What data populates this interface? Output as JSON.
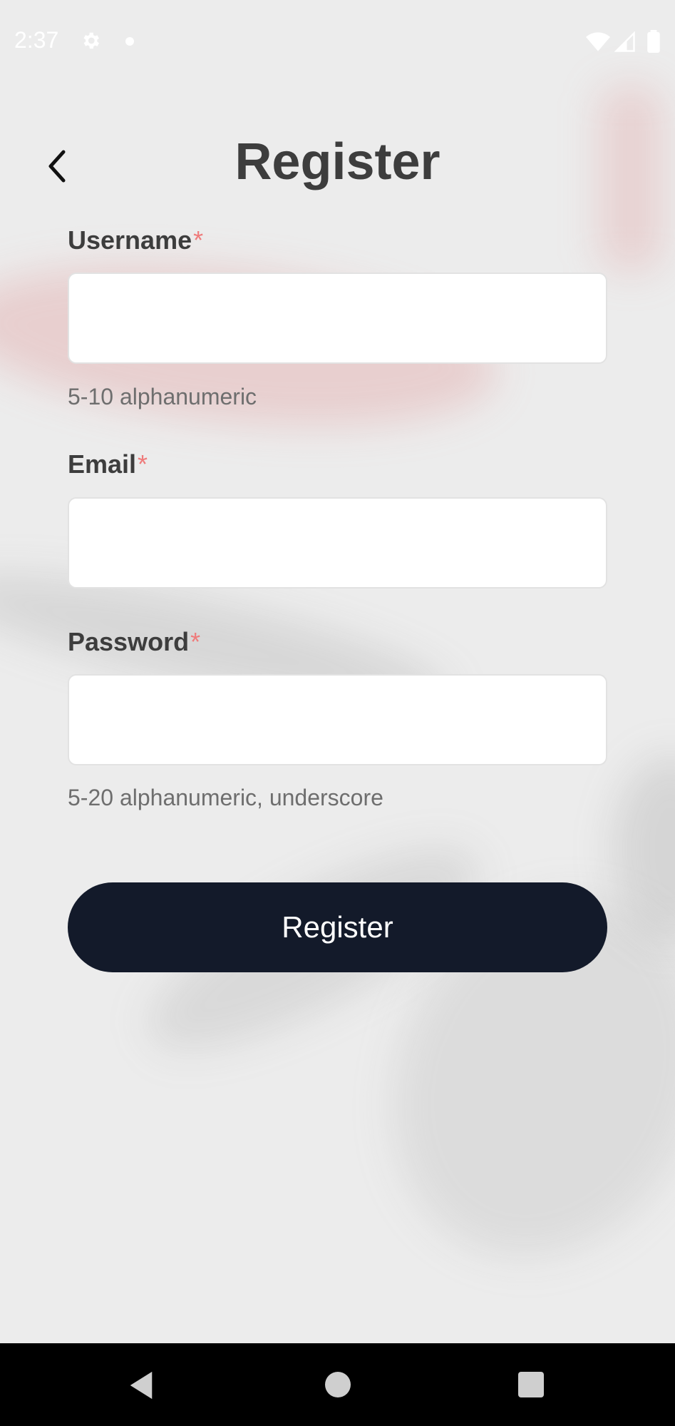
{
  "status_bar": {
    "time": "2:37",
    "icons": [
      "gear-icon",
      "dot-icon",
      "wifi-icon",
      "signal-icon",
      "battery-icon"
    ]
  },
  "header": {
    "back_icon": "chevron-left-icon",
    "title": "Register"
  },
  "form": {
    "username": {
      "label": "Username",
      "required_mark": "*",
      "value": "",
      "hint": "5-10 alphanumeric"
    },
    "email": {
      "label": "Email",
      "required_mark": "*",
      "value": ""
    },
    "password": {
      "label": "Password",
      "required_mark": "*",
      "value": "",
      "hint": "5-20 alphanumeric, underscore"
    },
    "submit_label": "Register"
  },
  "nav_bar": {
    "icons": [
      "nav-back-icon",
      "nav-home-icon",
      "nav-recents-icon"
    ]
  },
  "colors": {
    "button_bg": "#131a2a",
    "required": "#ef7b7b",
    "title_text": "#3d3d3d"
  }
}
